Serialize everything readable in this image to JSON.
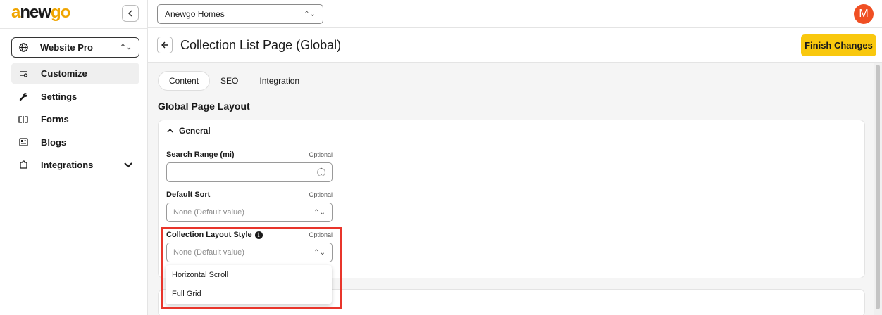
{
  "app": {
    "logo": {
      "a": "a",
      "n": "new",
      "g": "go"
    },
    "collapse_glyph": "‹"
  },
  "sidebar": {
    "site_selector": {
      "label": "Website Pro",
      "icon": "globe-icon"
    },
    "items": [
      {
        "label": "Customize",
        "icon": "sliders-icon",
        "active": true
      },
      {
        "label": "Settings",
        "icon": "wrench-icon"
      },
      {
        "label": "Forms",
        "icon": "form-icon"
      },
      {
        "label": "Blogs",
        "icon": "newspaper-icon"
      },
      {
        "label": "Integrations",
        "icon": "puzzle-icon",
        "expandable": true
      }
    ]
  },
  "topbar": {
    "tenant": "Anewgo Homes",
    "avatar_initial": "M",
    "avatar_color": "#f04f23"
  },
  "header": {
    "title": "Collection List Page (Global)",
    "finish_label": "Finish Changes",
    "accent": "#f9c80e"
  },
  "tabs": [
    "Content",
    "SEO",
    "Integration"
  ],
  "section_title": "Global Page Layout",
  "general": {
    "title": "General",
    "fields": [
      {
        "label": "Search Range (mi)",
        "optional": "Optional",
        "value": ""
      },
      {
        "label": "Default Sort",
        "optional": "Optional",
        "placeholder": "None (Default value)"
      },
      {
        "label": "Collection Layout Style",
        "optional": "Optional",
        "placeholder": "None (Default value)"
      }
    ]
  },
  "dropdown_options": [
    "Horizontal Scroll",
    "Full Grid"
  ],
  "highlight_color": "#e8352b"
}
